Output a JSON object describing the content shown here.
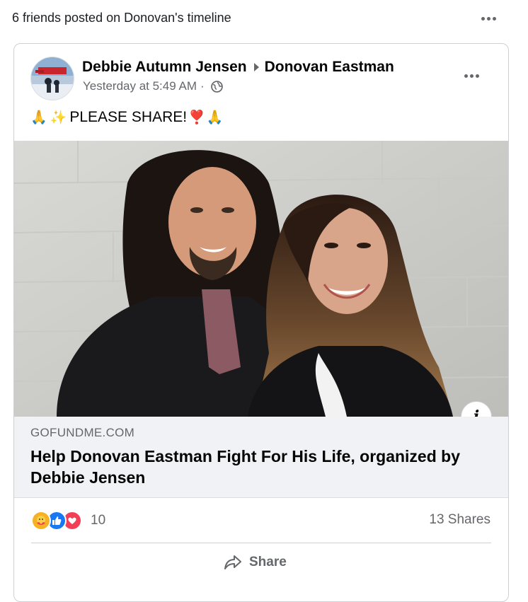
{
  "header": {
    "text": "6 friends posted on Donovan's timeline"
  },
  "post": {
    "author": "Debbie Autumn Jensen",
    "target": "Donovan Eastman",
    "timestamp": "Yesterday at 5:49 AM",
    "separator": "·",
    "privacy_icon": "globe-icon",
    "text": "PLEASE SHARE!",
    "emojis": {
      "pray": "🙏",
      "sparkles": "✨",
      "heart": "❣️"
    }
  },
  "link": {
    "domain": "GOFUNDME.COM",
    "title": "Help Donovan Eastman Fight For His Life, organized by Debbie Jensen",
    "info_label": "i"
  },
  "engagement": {
    "reaction_icons": [
      "care-icon",
      "like-icon",
      "love-icon"
    ],
    "reaction_count": "10",
    "shares": "13 Shares"
  },
  "actions": {
    "share_label": "Share"
  },
  "colors": {
    "like": "#1877f2",
    "love": "#f33e58",
    "care": "#f7b125",
    "secondary_text": "#65676b"
  }
}
